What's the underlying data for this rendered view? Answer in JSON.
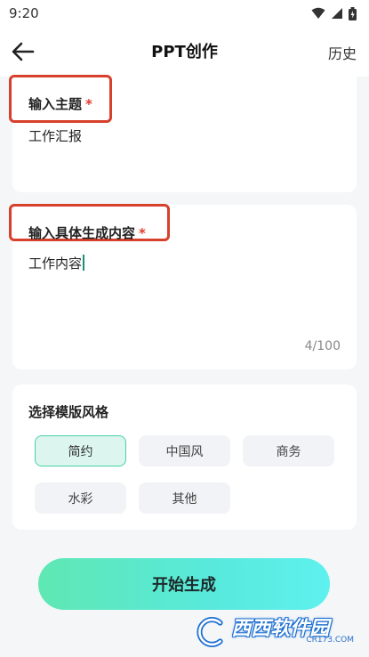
{
  "status_bar": {
    "time": "9:20",
    "icons": [
      "wifi-icon",
      "signal-icon",
      "battery-icon"
    ]
  },
  "header": {
    "title": "PPT创作",
    "history": "历史",
    "back_icon": "arrow-left-icon"
  },
  "topic": {
    "label": "输入主题",
    "required_mark": "*",
    "value": "工作汇报"
  },
  "content": {
    "label": "输入具体生成内容",
    "required_mark": "*",
    "value": "工作内容",
    "char_count": "4/100"
  },
  "template_style": {
    "title": "选择模版风格",
    "options": [
      "简约",
      "中国风",
      "商务",
      "水彩",
      "其他"
    ],
    "selected": "简约"
  },
  "start_button": {
    "label": "开始生成"
  },
  "watermark": {
    "text": "西西软件园",
    "sub": "CR173.COM"
  },
  "colors": {
    "accent": "#45d1a7",
    "required": "#e23b2c",
    "highlight": "#d7402b",
    "button_gradient_start": "#5fe8b3",
    "button_gradient_end": "#5ef1ee"
  }
}
